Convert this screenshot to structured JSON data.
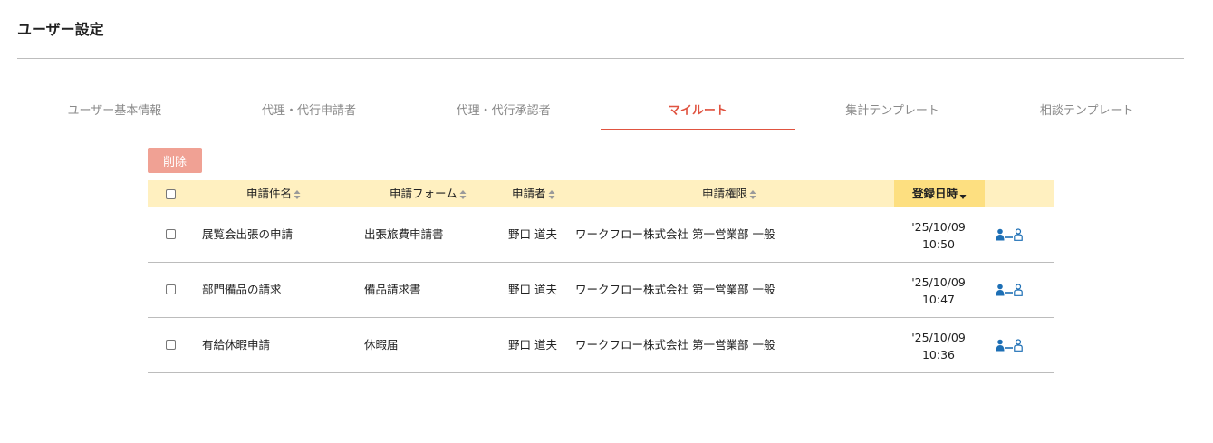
{
  "header": {
    "title": "ユーザー設定"
  },
  "tabs": [
    {
      "label": "ユーザー基本情報",
      "active": false
    },
    {
      "label": "代理・代行申請者",
      "active": false
    },
    {
      "label": "代理・代行承認者",
      "active": false
    },
    {
      "label": "マイルート",
      "active": true
    },
    {
      "label": "集計テンプレート",
      "active": false
    },
    {
      "label": "相談テンプレート",
      "active": false
    }
  ],
  "toolbar": {
    "delete_label": "削除"
  },
  "table": {
    "columns": {
      "subject": "申請件名",
      "form": "申請フォーム",
      "applicant": "申請者",
      "authority": "申請権限",
      "registered": "登録日時"
    },
    "rows": [
      {
        "subject": "展覧会出張の申請",
        "form": "出張旅費申請書",
        "applicant": "野口 道夫",
        "authority": "ワークフロー株式会社 第一営業部 一般",
        "date": "'25/10/09",
        "time": "10:50"
      },
      {
        "subject": "部門備品の請求",
        "form": "備品請求書",
        "applicant": "野口 道夫",
        "authority": "ワークフロー株式会社 第一営業部 一般",
        "date": "'25/10/09",
        "time": "10:47"
      },
      {
        "subject": "有給休暇申請",
        "form": "休暇届",
        "applicant": "野口 道夫",
        "authority": "ワークフロー株式会社 第一営業部 一般",
        "date": "'25/10/09",
        "time": "10:36"
      }
    ]
  },
  "colors": {
    "accent": "#e05340",
    "header_bg": "#fff0c0",
    "sorted_header_bg": "#fddf80",
    "delete_bg": "#f0a194",
    "icon_blue": "#1d6fb5"
  },
  "icons": {
    "sort": "sort-icon",
    "sorted_desc": "sort-desc-icon",
    "route": "user-route-icon"
  }
}
